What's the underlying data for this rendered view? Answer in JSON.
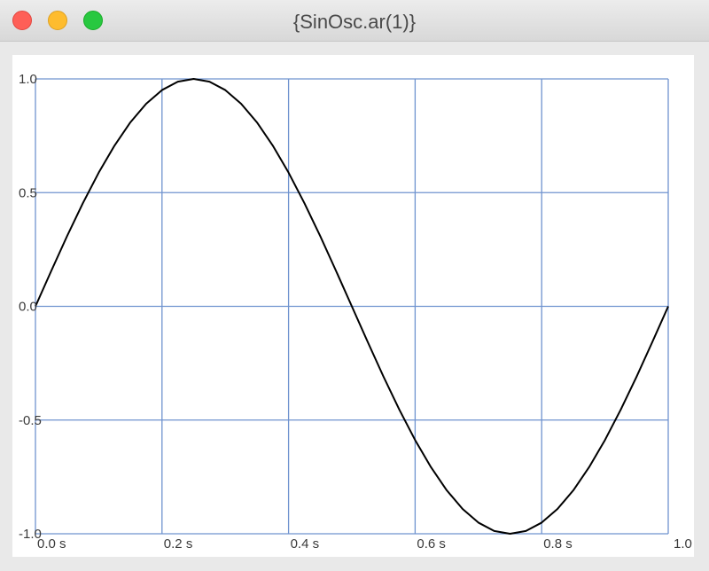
{
  "window": {
    "title": "{SinOsc.ar(1)}"
  },
  "chart_data": {
    "type": "line",
    "title": "",
    "xlabel": "",
    "ylabel": "",
    "xlim": [
      0,
      1
    ],
    "ylim": [
      -1,
      1
    ],
    "grid": true,
    "x_ticks": [
      {
        "value": 0.0,
        "label": "0.0 s"
      },
      {
        "value": 0.2,
        "label": "0.2 s"
      },
      {
        "value": 0.4,
        "label": "0.4 s"
      },
      {
        "value": 0.6,
        "label": "0.6 s"
      },
      {
        "value": 0.8,
        "label": "0.8 s"
      },
      {
        "value": 1.0,
        "label": "1.0"
      }
    ],
    "y_ticks": [
      {
        "value": 1.0,
        "label": "1.0"
      },
      {
        "value": 0.5,
        "label": "0.5"
      },
      {
        "value": 0.0,
        "label": "0.0"
      },
      {
        "value": -0.5,
        "label": "-0.5"
      },
      {
        "value": -1.0,
        "label": "-1.0"
      }
    ],
    "series": [
      {
        "color": "#000000",
        "x": [
          0.0,
          0.025,
          0.05,
          0.075,
          0.1,
          0.125,
          0.15,
          0.175,
          0.2,
          0.225,
          0.25,
          0.275,
          0.3,
          0.325,
          0.35,
          0.375,
          0.4,
          0.425,
          0.45,
          0.475,
          0.5,
          0.525,
          0.55,
          0.575,
          0.6,
          0.625,
          0.65,
          0.675,
          0.7,
          0.725,
          0.75,
          0.775,
          0.8,
          0.825,
          0.85,
          0.875,
          0.9,
          0.925,
          0.95,
          0.975,
          1.0
        ],
        "values": [
          0.0,
          0.156,
          0.309,
          0.454,
          0.588,
          0.707,
          0.809,
          0.891,
          0.951,
          0.988,
          1.0,
          0.988,
          0.951,
          0.891,
          0.809,
          0.707,
          0.588,
          0.454,
          0.309,
          0.156,
          0.0,
          -0.156,
          -0.309,
          -0.454,
          -0.588,
          -0.707,
          -0.809,
          -0.891,
          -0.951,
          -0.988,
          -1.0,
          -0.988,
          -0.951,
          -0.891,
          -0.809,
          -0.707,
          -0.588,
          -0.454,
          -0.309,
          -0.156,
          0.0
        ]
      }
    ],
    "colors": {
      "grid": "#6f93cf",
      "line": "#000000",
      "background": "#ffffff"
    }
  }
}
